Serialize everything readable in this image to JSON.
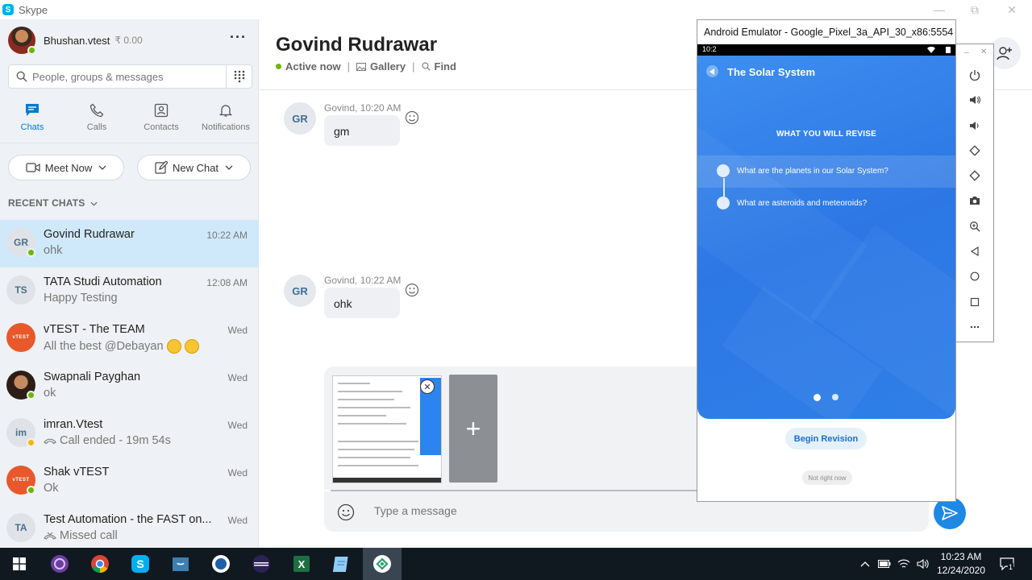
{
  "window": {
    "title": "Skype"
  },
  "profile": {
    "name": "Bhushan.vtest",
    "credit": "₹ 0.00"
  },
  "search": {
    "placeholder": "People, groups & messages"
  },
  "nav": [
    {
      "label": "Chats",
      "icon": "chat-icon",
      "active": true
    },
    {
      "label": "Calls",
      "icon": "phone-icon",
      "active": false
    },
    {
      "label": "Contacts",
      "icon": "contacts-icon",
      "active": false
    },
    {
      "label": "Notifications",
      "icon": "bell-icon",
      "active": false
    }
  ],
  "actions": {
    "meet_now": "Meet Now",
    "new_chat": "New Chat"
  },
  "recent_chats": {
    "heading": "RECENT CHATS",
    "items": [
      {
        "initials": "GR",
        "name": "Govind Rudrawar",
        "time": "10:22 AM",
        "message": "ohk"
      },
      {
        "initials": "TS",
        "name": "TATA Studi Automation",
        "time": "12:08 AM",
        "message": "Happy Testing"
      },
      {
        "initials": "vTEST",
        "name": "vTEST - The TEAM",
        "time": "Wed",
        "message": "All the best @Debayan"
      },
      {
        "initials": "",
        "name": "Swapnali Payghan",
        "time": "Wed",
        "message": "ok"
      },
      {
        "initials": "im",
        "name": "imran.Vtest",
        "time": "Wed",
        "message": "Call ended - 19m 54s"
      },
      {
        "initials": "vTEST",
        "name": "Shak vTEST",
        "time": "Wed",
        "message": "Ok"
      },
      {
        "initials": "TA",
        "name": "Test Automation - the FAST on...",
        "time": "Wed",
        "message": "Missed call"
      }
    ]
  },
  "conversation": {
    "title": "Govind Rudrawar",
    "status": "Active now",
    "gallery": "Gallery",
    "find": "Find",
    "messages": [
      {
        "initials": "GR",
        "meta": "Govind, 10:20 AM",
        "text": "gm"
      },
      {
        "initials": "GR",
        "meta": "Govind, 10:22 AM",
        "text": "ohk"
      }
    ],
    "compose_placeholder": "Type a message",
    "add_tile": "+"
  },
  "emulator": {
    "title": "Android Emulator - Google_Pixel_3a_API_30_x86:5554",
    "status_time": "10:2",
    "app_title": "The Solar System",
    "section": "WHAT YOU WILL REVISE",
    "items": [
      "What are the planets in our Solar System?",
      "What are asteroids and meteoroids?"
    ],
    "begin": "Begin Revision",
    "not_now": "Not right now",
    "page_indicator": {
      "pages": 2,
      "current": 1
    }
  },
  "taskbar": {
    "time": "10:23 AM",
    "date": "12/24/2020",
    "notifications": "1"
  },
  "colors": {
    "accent": "#0078d4",
    "online": "#6bb700",
    "emulator_blue": "#2f80ed",
    "selected_chat": "#cfe9fb"
  }
}
